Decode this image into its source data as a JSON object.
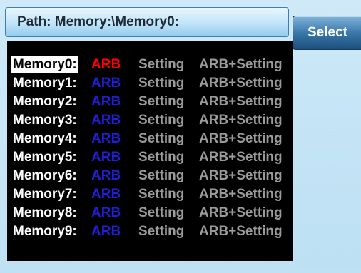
{
  "path_bar": {
    "label": "Path: Memory:\\Memory0:"
  },
  "softkey": {
    "select_label": "Select"
  },
  "colors": {
    "background": "#c6e4f5",
    "list_background": "#000000",
    "arb_active": "#ff0000",
    "arb_normal": "#1f1fd6",
    "disabled_text": "#9a9a9a"
  },
  "memory_list": {
    "selected_index": 0,
    "rows": [
      {
        "name": "Memory0:",
        "arb": "ARB",
        "setting": "Setting",
        "arb_setting": "ARB+Setting"
      },
      {
        "name": "Memory1:",
        "arb": "ARB",
        "setting": "Setting",
        "arb_setting": "ARB+Setting"
      },
      {
        "name": "Memory2:",
        "arb": "ARB",
        "setting": "Setting",
        "arb_setting": "ARB+Setting"
      },
      {
        "name": "Memory3:",
        "arb": "ARB",
        "setting": "Setting",
        "arb_setting": "ARB+Setting"
      },
      {
        "name": "Memory4:",
        "arb": "ARB",
        "setting": "Setting",
        "arb_setting": "ARB+Setting"
      },
      {
        "name": "Memory5:",
        "arb": "ARB",
        "setting": "Setting",
        "arb_setting": "ARB+Setting"
      },
      {
        "name": "Memory6:",
        "arb": "ARB",
        "setting": "Setting",
        "arb_setting": "ARB+Setting"
      },
      {
        "name": "Memory7:",
        "arb": "ARB",
        "setting": "Setting",
        "arb_setting": "ARB+Setting"
      },
      {
        "name": "Memory8:",
        "arb": "ARB",
        "setting": "Setting",
        "arb_setting": "ARB+Setting"
      },
      {
        "name": "Memory9:",
        "arb": "ARB",
        "setting": "Setting",
        "arb_setting": "ARB+Setting"
      }
    ]
  }
}
